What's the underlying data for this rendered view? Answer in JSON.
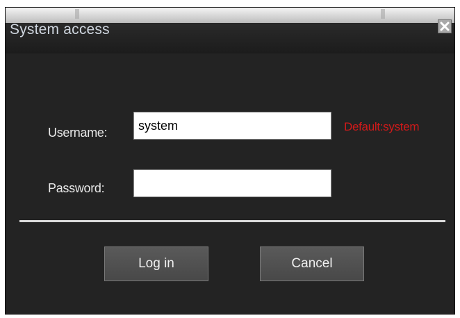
{
  "window": {
    "title": "System access"
  },
  "form": {
    "username_label": "Username:",
    "username_value": "system",
    "username_hint": "Default:system",
    "password_label": "Password:",
    "password_value": ""
  },
  "buttons": {
    "login_label": "Log in",
    "cancel_label": "Cancel"
  },
  "icons": {
    "close": "close-icon"
  },
  "colors": {
    "background": "#232323",
    "hint": "#d11a1a",
    "title_text": "#cfd6df",
    "button": "#525252"
  }
}
